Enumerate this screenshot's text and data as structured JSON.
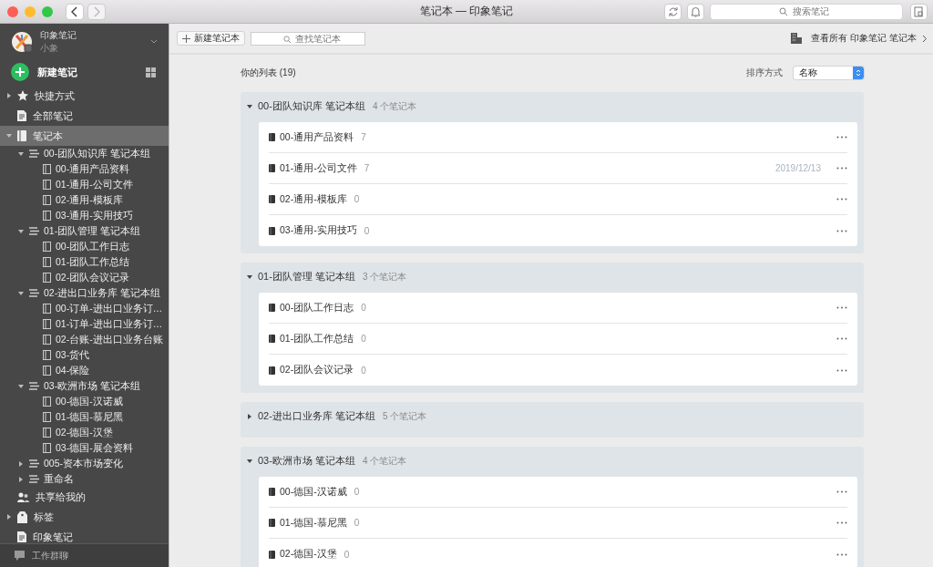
{
  "window": {
    "title": "笔记本 — 印象笔记",
    "search": {
      "placeholder": "搜索笔记"
    }
  },
  "sidebar": {
    "account": {
      "name": "印象笔记",
      "user": "小象"
    },
    "new_note": "新建笔记",
    "items": [
      {
        "kind": "shortcuts",
        "label": "快捷方式",
        "expanded": false,
        "selected": false
      },
      {
        "kind": "all_notes",
        "label": "全部笔记",
        "selected": false
      },
      {
        "kind": "notebooks",
        "label": "笔记本",
        "expanded": true,
        "selected": true,
        "children": [
          {
            "kind": "stack",
            "label": "00-团队知识库 笔记本组",
            "expanded": true,
            "selected": false,
            "children": [
              {
                "kind": "notebook",
                "label": "00-通用产品资料",
                "selected": false
              },
              {
                "kind": "notebook",
                "label": "01-通用-公司文件",
                "selected": false
              },
              {
                "kind": "notebook",
                "label": "02-通用-模板库",
                "selected": false
              },
              {
                "kind": "notebook",
                "label": "03-通用-实用技巧",
                "selected": false
              }
            ]
          },
          {
            "kind": "stack",
            "label": "01-团队管理 笔记本组",
            "expanded": true,
            "selected": false,
            "children": [
              {
                "kind": "notebook",
                "label": "00-团队工作日志",
                "selected": false
              },
              {
                "kind": "notebook",
                "label": "01-团队工作总结",
                "selected": false
              },
              {
                "kind": "notebook",
                "label": "02-团队会议记录",
                "selected": false
              }
            ]
          },
          {
            "kind": "stack",
            "label": "02-进出口业务库 笔记本组",
            "expanded": true,
            "selected": false,
            "children": [
              {
                "kind": "notebook",
                "label": "00-订单-进出口业务订…",
                "selected": false
              },
              {
                "kind": "notebook",
                "label": "01-订单-进出口业务订…",
                "selected": false
              },
              {
                "kind": "notebook",
                "label": "02-台账-进出口业务台账",
                "selected": false
              },
              {
                "kind": "notebook",
                "label": "03-货代",
                "selected": false
              },
              {
                "kind": "notebook",
                "label": "04-保险",
                "selected": false
              }
            ]
          },
          {
            "kind": "stack",
            "label": "03-欧洲市场 笔记本组",
            "expanded": true,
            "selected": false,
            "children": [
              {
                "kind": "notebook",
                "label": "00-德国-汉诺威",
                "selected": false
              },
              {
                "kind": "notebook",
                "label": "01-德国-慕尼黑",
                "selected": false
              },
              {
                "kind": "notebook",
                "label": "02-德国-汉堡",
                "selected": false
              },
              {
                "kind": "notebook",
                "label": "03-德国-展会资料",
                "selected": false
              }
            ]
          },
          {
            "kind": "stack",
            "label": "005-资本市场变化",
            "expanded": false,
            "selected": false
          },
          {
            "kind": "stack",
            "label": "重命名",
            "expanded": false,
            "selected": false
          }
        ]
      },
      {
        "kind": "shared",
        "label": "共享给我的",
        "selected": false
      },
      {
        "kind": "tags",
        "label": "标签",
        "expanded": false,
        "selected": false
      },
      {
        "kind": "all_notes",
        "label": "印象笔记",
        "selected": false
      }
    ],
    "footer": "工作群聊"
  },
  "main": {
    "new_notebook": "新建笔记本",
    "search": {
      "placeholder": "查找笔记本"
    },
    "view_all": "查看所有 印象笔记 笔记本",
    "list_title": "你的列表 (19)",
    "sort": {
      "label": "排序方式",
      "value": "名称"
    },
    "groups": [
      {
        "name": "00-团队知识库 笔记本组",
        "count": "4 个笔记本",
        "expanded": true,
        "notebooks": [
          {
            "name": "00-通用产品资料",
            "count": "7"
          },
          {
            "name": "01-通用-公司文件",
            "count": "7",
            "date": "2019/12/13"
          },
          {
            "name": "02-通用-模板库",
            "count": "0"
          },
          {
            "name": "03-通用-实用技巧",
            "count": "0"
          }
        ]
      },
      {
        "name": "01-团队管理 笔记本组",
        "count": "3 个笔记本",
        "expanded": true,
        "notebooks": [
          {
            "name": "00-团队工作日志",
            "count": "0"
          },
          {
            "name": "01-团队工作总结",
            "count": "0"
          },
          {
            "name": "02-团队会议记录",
            "count": "0"
          }
        ]
      },
      {
        "name": "02-进出口业务库 笔记本组",
        "count": "5 个笔记本",
        "expanded": false
      },
      {
        "name": "03-欧洲市场 笔记本组",
        "count": "4 个笔记本",
        "expanded": true,
        "notebooks": [
          {
            "name": "00-德国-汉诺威",
            "count": "0"
          },
          {
            "name": "01-德国-慕尼黑",
            "count": "0"
          },
          {
            "name": "02-德国-汉堡",
            "count": "0"
          }
        ]
      }
    ]
  }
}
